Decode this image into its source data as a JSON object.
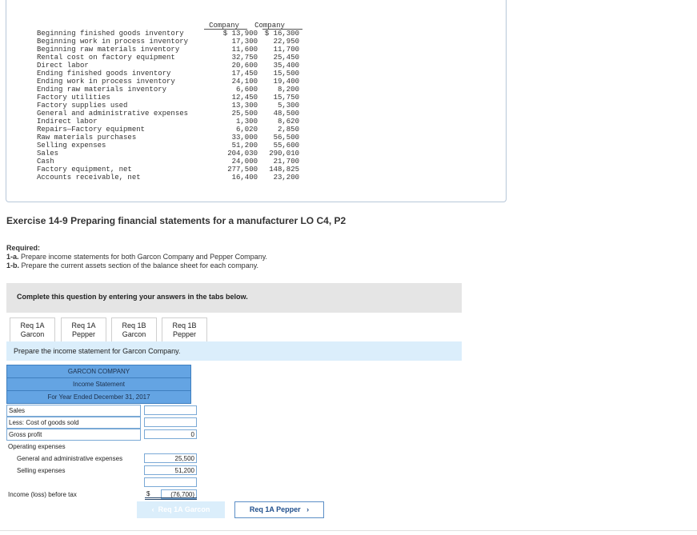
{
  "data_table": {
    "col_a_header": "Company",
    "col_b_header": "Company",
    "rows": [
      {
        "label": "Beginning finished goods inventory",
        "a": "$ 13,900",
        "b": "$ 16,300"
      },
      {
        "label": "Beginning work in process inventory",
        "a": "17,300",
        "b": "22,950"
      },
      {
        "label": "Beginning raw materials inventory",
        "a": "11,600",
        "b": "11,700"
      },
      {
        "label": "Rental cost on factory equipment",
        "a": "32,750",
        "b": "25,450"
      },
      {
        "label": "Direct labor",
        "a": "20,600",
        "b": "35,400"
      },
      {
        "label": "Ending finished goods inventory",
        "a": "17,450",
        "b": "15,500"
      },
      {
        "label": "Ending work in process inventory",
        "a": "24,100",
        "b": "19,400"
      },
      {
        "label": "Ending raw materials inventory",
        "a": "6,600",
        "b": "8,200"
      },
      {
        "label": "Factory utilities",
        "a": "12,450",
        "b": "15,750"
      },
      {
        "label": "Factory supplies used",
        "a": "13,300",
        "b": "5,300"
      },
      {
        "label": "General and administrative expenses",
        "a": "25,500",
        "b": "48,500"
      },
      {
        "label": "Indirect labor",
        "a": "1,300",
        "b": "8,620"
      },
      {
        "label": "Repairs—Factory equipment",
        "a": "6,020",
        "b": "2,850"
      },
      {
        "label": "Raw materials purchases",
        "a": "33,000",
        "b": "56,500"
      },
      {
        "label": "Selling expenses",
        "a": "51,200",
        "b": "55,600"
      },
      {
        "label": "Sales",
        "a": "204,030",
        "b": "290,010"
      },
      {
        "label": "Cash",
        "a": "24,000",
        "b": "21,700"
      },
      {
        "label": "Factory equipment, net",
        "a": "277,500",
        "b": "148,825"
      },
      {
        "label": "Accounts receivable, net",
        "a": "16,400",
        "b": "23,200"
      }
    ]
  },
  "exercise_title": "Exercise 14-9 Preparing financial statements for a manufacturer LO C4, P2",
  "required": {
    "heading": "Required:",
    "item_a_key": "1-a.",
    "item_a_text": "Prepare income statements for both Garcon Company and Pepper Company.",
    "item_b_key": "1-b.",
    "item_b_text": "Prepare the current assets section of the balance sheet for each company."
  },
  "complete_prompt": "Complete this question by entering your answers in the tabs below.",
  "tabs": [
    {
      "line1": "Req 1A",
      "line2": "Garcon"
    },
    {
      "line1": "Req 1A",
      "line2": "Pepper"
    },
    {
      "line1": "Req 1B",
      "line2": "Garcon"
    },
    {
      "line1": "Req 1B",
      "line2": "Pepper"
    }
  ],
  "instruction": "Prepare the income statement for Garcon Company.",
  "statement": {
    "company": "GARCON COMPANY",
    "name": "Income Statement",
    "period": "For Year Ended December 31, 2017",
    "sales_label": "Sales",
    "sales_value": "",
    "cogs_label": "Less: Cost of goods sold",
    "cogs_value": "",
    "gross_profit_label": "Gross profit",
    "gross_profit_value": "0",
    "opex_label": "Operating expenses",
    "ga_label": "General and administrative expenses",
    "ga_value": "25,500",
    "selling_label": "Selling expenses",
    "selling_value": "51,200",
    "empty_row_value": "",
    "income_label": "Income (loss) before tax",
    "income_currency": "$",
    "income_value": "(76,700)"
  },
  "nav": {
    "prev_label": "Req 1A Garcon",
    "next_label": "Req 1A Pepper"
  }
}
